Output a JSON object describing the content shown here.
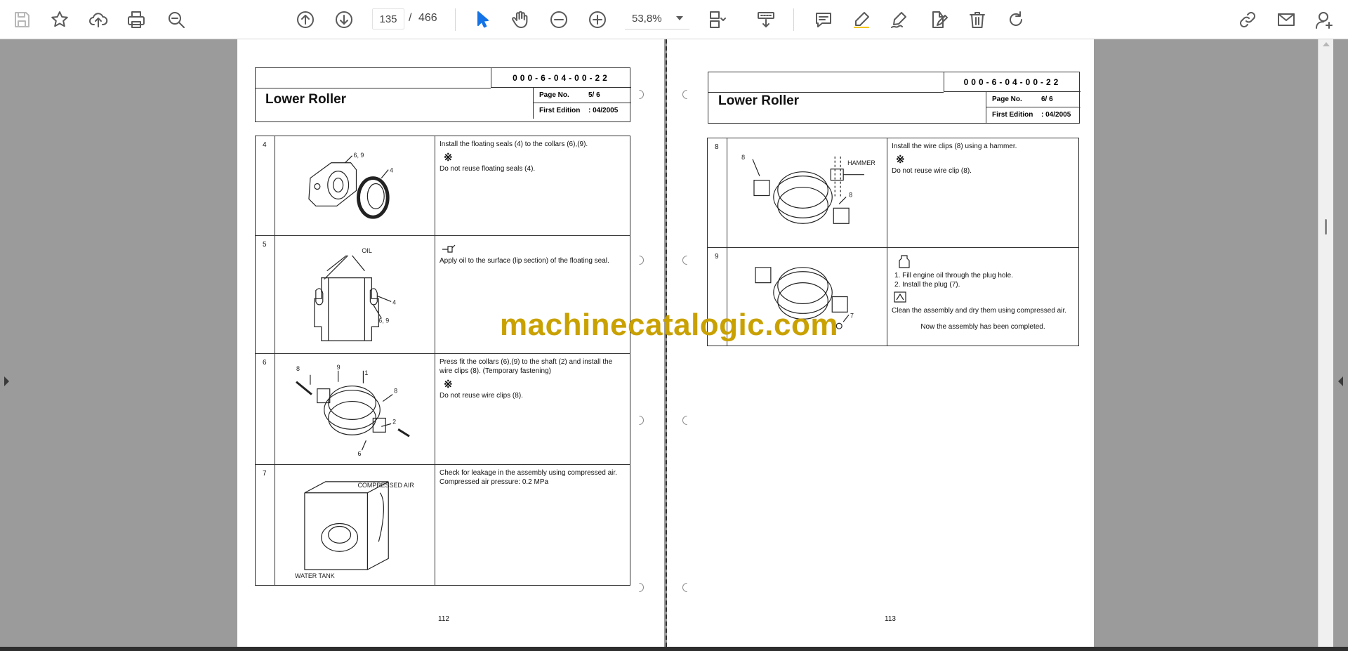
{
  "toolbar": {
    "current_page": "135",
    "page_separator": "/",
    "total_pages": "466",
    "zoom": "53,8%"
  },
  "left_page": {
    "doc_code": "000-6-04-00-22",
    "title": "Lower Roller",
    "page_no_label": "Page No.",
    "page_no_value": "5/ 6",
    "edition_label": "First Edition",
    "edition_value": ": 04/2005",
    "page_number": "112",
    "steps": [
      {
        "num": "4",
        "text": "Install the floating seals (4) to the collars (6),(9).",
        "mark": "※",
        "note": "Do not reuse floating seals (4).",
        "labels": [
          "6, 9",
          "4"
        ]
      },
      {
        "num": "5",
        "mark": "oil-can-icon",
        "text": "Apply oil to the surface (lip section) of the floating seal.",
        "labels": [
          "OIL",
          "4",
          "6, 9"
        ]
      },
      {
        "num": "6",
        "text": "Press fit the collars (6),(9) to the shaft (2) and install the wire clips (8). (Temporary fastening)",
        "mark": "※",
        "note": "Do not reuse wire clips (8).",
        "labels": [
          "8",
          "9",
          "1",
          "8",
          "2",
          "6"
        ]
      },
      {
        "num": "7",
        "text": "Check for leakage in the assembly using compressed air.",
        "note": "Compressed air pressure: 0.2 MPa",
        "labels": [
          "COMPRESSED AIR",
          "WATER TANK"
        ]
      }
    ]
  },
  "right_page": {
    "doc_code": "000-6-04-00-22",
    "title": "Lower Roller",
    "page_no_label": "Page No.",
    "page_no_value": "6/ 6",
    "edition_label": "First Edition",
    "edition_value": ": 04/2005",
    "page_number": "113",
    "steps": [
      {
        "num": "8",
        "text": "Install the wire clips (8) using a hammer.",
        "mark": "※",
        "note": "Do not reuse wire clip (8).",
        "labels": [
          "8",
          "HAMMER",
          "8"
        ]
      },
      {
        "num": "9",
        "items": [
          "1. Fill engine oil through the plug hole.",
          "2. Install the plug (7)."
        ],
        "note": "Clean the assembly and dry them using compressed air.",
        "done": "Now the assembly has been completed.",
        "labels": [
          "7"
        ]
      }
    ]
  },
  "watermark": "machinecatalogic.com",
  "colors": {
    "accent": "#1473e6",
    "watermark": "#c9a100",
    "viewer_background": "#9b9b9b"
  }
}
